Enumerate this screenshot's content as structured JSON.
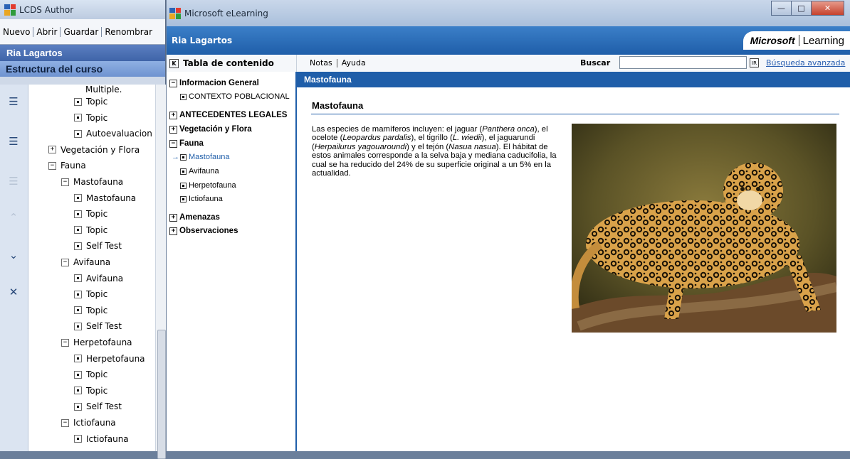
{
  "lcds": {
    "title": "LCDS Author",
    "menu": [
      {
        "label": "Nuevo"
      },
      {
        "label": "Abrir"
      },
      {
        "label": "Guardar"
      },
      {
        "label": "Renombrar"
      }
    ],
    "course_title": "Ria Lagartos",
    "structure_title": "Estructura del curso",
    "tree": [
      {
        "label": "Multiple.",
        "kind": "text",
        "level": 3
      },
      {
        "label": "Topic",
        "kind": "dot",
        "level": 3
      },
      {
        "label": "Topic",
        "kind": "dot",
        "level": 3
      },
      {
        "label": "Autoevaluacion",
        "kind": "dot",
        "level": 3
      },
      {
        "label": "Vegetación y Flora",
        "kind": "plus",
        "level": 1
      },
      {
        "label": "Fauna",
        "kind": "minus",
        "level": 1
      },
      {
        "label": "Mastofauna",
        "kind": "minus",
        "level": 2
      },
      {
        "label": "Mastofauna",
        "kind": "dot",
        "level": 3
      },
      {
        "label": "Topic",
        "kind": "dot",
        "level": 3
      },
      {
        "label": "Topic",
        "kind": "dot",
        "level": 3
      },
      {
        "label": "Self Test",
        "kind": "dot",
        "level": 3
      },
      {
        "label": "Avifauna",
        "kind": "minus",
        "level": 2
      },
      {
        "label": "Avifauna",
        "kind": "dot",
        "level": 3
      },
      {
        "label": "Topic",
        "kind": "dot",
        "level": 3
      },
      {
        "label": "Topic",
        "kind": "dot",
        "level": 3
      },
      {
        "label": "Self Test",
        "kind": "dot",
        "level": 3
      },
      {
        "label": "Herpetofauna",
        "kind": "minus",
        "level": 2
      },
      {
        "label": "Herpetofauna",
        "kind": "dot",
        "level": 3
      },
      {
        "label": "Topic",
        "kind": "dot",
        "level": 3
      },
      {
        "label": "Topic",
        "kind": "dot",
        "level": 3
      },
      {
        "label": "Self Test",
        "kind": "dot",
        "level": 3
      },
      {
        "label": "Ictiofauna",
        "kind": "minus",
        "level": 2
      },
      {
        "label": "Ictiofauna",
        "kind": "dot",
        "level": 3
      }
    ]
  },
  "elearning": {
    "title": "Microsoft eLearning",
    "course_name": "Ria Lagartos",
    "logo_text": "Microsoft",
    "logo_suffix": "Learning",
    "toc_title": "Tabla de contenido",
    "nav_notes": "Notas",
    "nav_help": "Ayuda",
    "search_label": "Buscar",
    "search_value": "",
    "ir_label": "IR",
    "advanced_search": "Búsqueda avanzada",
    "toc": [
      {
        "label": "Informacion General",
        "kind": "minus",
        "bold": true
      },
      {
        "label": "CONTEXTO POBLACIONAL",
        "kind": "dot",
        "bold": false
      },
      {
        "label": "ANTECEDENTES LEGALES",
        "kind": "plus",
        "bold": true
      },
      {
        "label": "Vegetación y Flora",
        "kind": "plus",
        "bold": true
      },
      {
        "label": "Fauna",
        "kind": "minus",
        "bold": true
      },
      {
        "label": "Mastofauna",
        "kind": "dot",
        "bold": false,
        "current": true
      },
      {
        "label": "Avifauna",
        "kind": "dot",
        "bold": false
      },
      {
        "label": "Herpetofauna",
        "kind": "dot",
        "bold": false
      },
      {
        "label": "Ictiofauna",
        "kind": "dot",
        "bold": false
      },
      {
        "label": "Amenazas",
        "kind": "plus",
        "bold": true
      },
      {
        "label": "Observaciones",
        "kind": "plus",
        "bold": true
      }
    ],
    "content_bar": "Mastofauna",
    "page_title": "Mastofauna",
    "paragraph": [
      {
        "t": "Las especies de mamíferos incluyen: el jaguar (",
        "i": false
      },
      {
        "t": "Panthera onca",
        "i": true
      },
      {
        "t": "), el ocelote (",
        "i": false
      },
      {
        "t": "Leopardus pardalis",
        "i": true
      },
      {
        "t": "), el tigrillo (",
        "i": false
      },
      {
        "t": "L. wiedii",
        "i": true
      },
      {
        "t": "), el jaguarundi (",
        "i": false
      },
      {
        "t": "Herpailurus yagouaroundi",
        "i": true
      },
      {
        "t": ") y el tejón (",
        "i": false
      },
      {
        "t": "Nasua nasua",
        "i": true
      },
      {
        "t": "). El hábitat de estos animales corresponde a la selva baja y mediana caducifolia, la cual se ha reducido del 24% de su superficie original a un 5% en la actualidad.",
        "i": false
      }
    ]
  },
  "colors": {
    "accent": "#1f5ea9",
    "header": "#2f70bb"
  }
}
